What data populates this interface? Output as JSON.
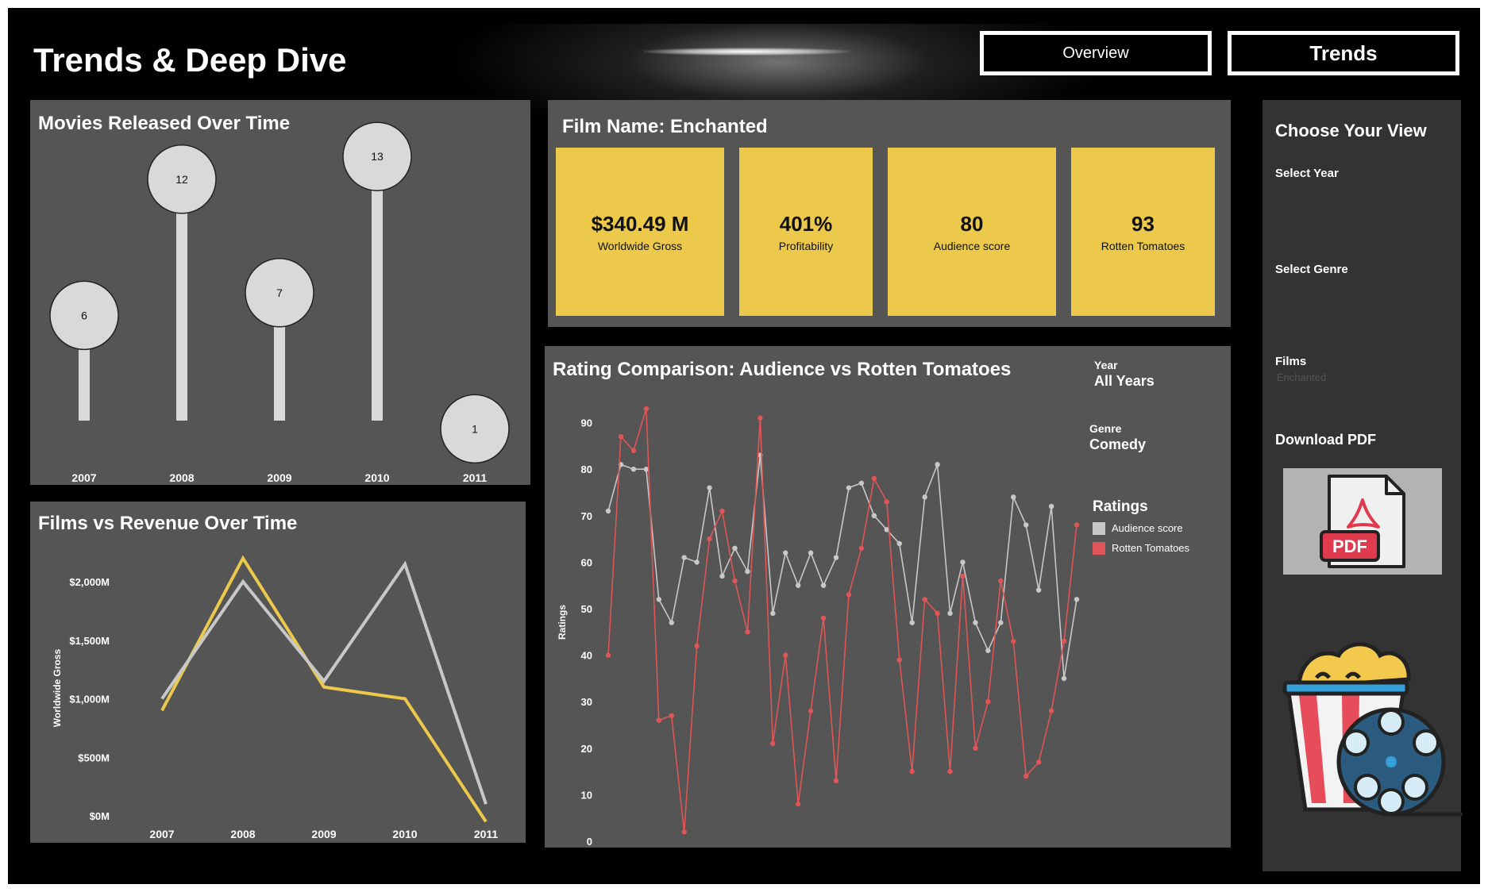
{
  "page_title": "Trends & Deep Dive",
  "nav": {
    "overview": "Overview",
    "trends": "Trends"
  },
  "film": {
    "heading": "Film Name: Enchanted",
    "kpis": [
      {
        "value": "$340.49 M",
        "label": "Worldwide Gross"
      },
      {
        "value": "401%",
        "label": "Profitability"
      },
      {
        "value": "80",
        "label": "Audience  score"
      },
      {
        "value": "93",
        "label": "Rotten Tomatoes"
      }
    ]
  },
  "sidebar": {
    "title": "Choose Your View",
    "select_year": "Select Year",
    "select_genre": "Select Genre",
    "films_label": "Films",
    "films_value": "Enchanted",
    "download": "Download PDF",
    "pdf_text": "PDF"
  },
  "rating_filters": {
    "year_label": "Year",
    "year_value": "All Years",
    "genre_label": "Genre",
    "genre_value": "Comedy",
    "legend_title": "Ratings"
  },
  "colors": {
    "yellow": "#ecc94b",
    "grey": "#c8c8c8",
    "red": "#e05555",
    "panel": "#555555"
  },
  "chart_data": [
    {
      "type": "lollipop",
      "title": "Movies Released Over Time",
      "categories": [
        "2007",
        "2008",
        "2009",
        "2010",
        "2011"
      ],
      "values": [
        6,
        12,
        7,
        13,
        1
      ]
    },
    {
      "type": "line",
      "title": "Films vs Revenue Over Time",
      "ylabel": "Worldwide Gross",
      "categories": [
        "2007",
        "2008",
        "2009",
        "2010",
        "2011"
      ],
      "yticks": [
        "$0M",
        "$500M",
        "$1,000M",
        "$1,500M",
        "$2,000M"
      ],
      "ylim": [
        0,
        2000
      ],
      "series": [
        {
          "color": "#ecc94b",
          "values": [
            900,
            2200,
            1100,
            1000,
            -50
          ]
        },
        {
          "color": "#c8c8c8",
          "values": [
            1000,
            2000,
            1150,
            2150,
            100
          ]
        }
      ]
    },
    {
      "type": "line",
      "title": "Rating Comparison: Audience vs Rotten Tomatoes",
      "ylabel": "Ratings",
      "ylim": [
        0,
        90
      ],
      "yticks": [
        0,
        10,
        20,
        30,
        40,
        50,
        60,
        70,
        80,
        90
      ],
      "series": [
        {
          "name": "Audience  score",
          "color": "#c8c8c8",
          "values": [
            71,
            81,
            80,
            80,
            52,
            47,
            61,
            60,
            76,
            57,
            63,
            58,
            83,
            49,
            62,
            55,
            62,
            55,
            61,
            76,
            77,
            70,
            67,
            64,
            47,
            74,
            81,
            49,
            60,
            47,
            41,
            47,
            74,
            68,
            54,
            72,
            35,
            52
          ]
        },
        {
          "name": "Rotten Tomatoes",
          "color": "#e05555",
          "values": [
            40,
            87,
            84,
            93,
            26,
            27,
            2,
            42,
            65,
            71,
            56,
            45,
            91,
            21,
            40,
            8,
            28,
            48,
            13,
            53,
            63,
            78,
            73,
            39,
            15,
            52,
            49,
            15,
            57,
            20,
            30,
            56,
            43,
            14,
            17,
            28,
            43,
            68
          ]
        }
      ]
    }
  ]
}
